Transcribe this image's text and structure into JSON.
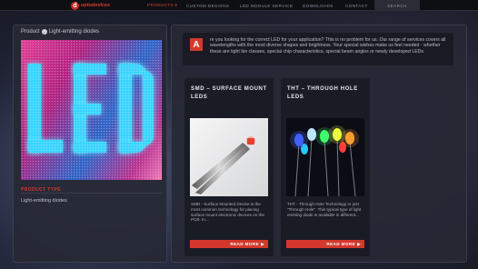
{
  "brand": {
    "name": "optodevices"
  },
  "nav": {
    "items": [
      {
        "label": "PRODUCTS ▾",
        "active": true
      },
      {
        "label": "CUSTOM DESIGNS",
        "active": false
      },
      {
        "label": "LED MODULE SERVICE",
        "active": false
      },
      {
        "label": "DOWNLOADS",
        "active": false
      },
      {
        "label": "CONTACT",
        "active": false
      }
    ],
    "search": "SEARCH"
  },
  "sidebar": {
    "breadcrumb": {
      "root": "Product",
      "current": "Light-emitting diodes"
    },
    "product_type_label": "PRODUCT TYPE",
    "product_type_value": "Light-emitting diodes"
  },
  "intro": {
    "drop_cap": "A",
    "text": "re you looking for the correct LED for your application? This is no problem for us. Our range of services covers all wavelengths with the most diverse shapes and brightness. Your special wishes make us feel needed - whether these are tight bin classes, special chip characteristics, special beam angles or newly developed LEDs."
  },
  "cards": [
    {
      "title": "SMD – SURFACE MOUNT LEDS",
      "text": "SMD - Surface Mounted Device is the most common technology for placing surface mount electronic devices on the PCB. In...",
      "button": "READ MORE"
    },
    {
      "title": "THT – THROUGH HOLE LEDS",
      "text": "THT - Through Hole Technology or just \"Through Hole\". This typical type of light emitting diode is available in different...",
      "button": "READ MORE"
    }
  ],
  "colors": {
    "accent": "#d3382c",
    "panel": "#262834",
    "led_glow": "#36d4ff"
  }
}
